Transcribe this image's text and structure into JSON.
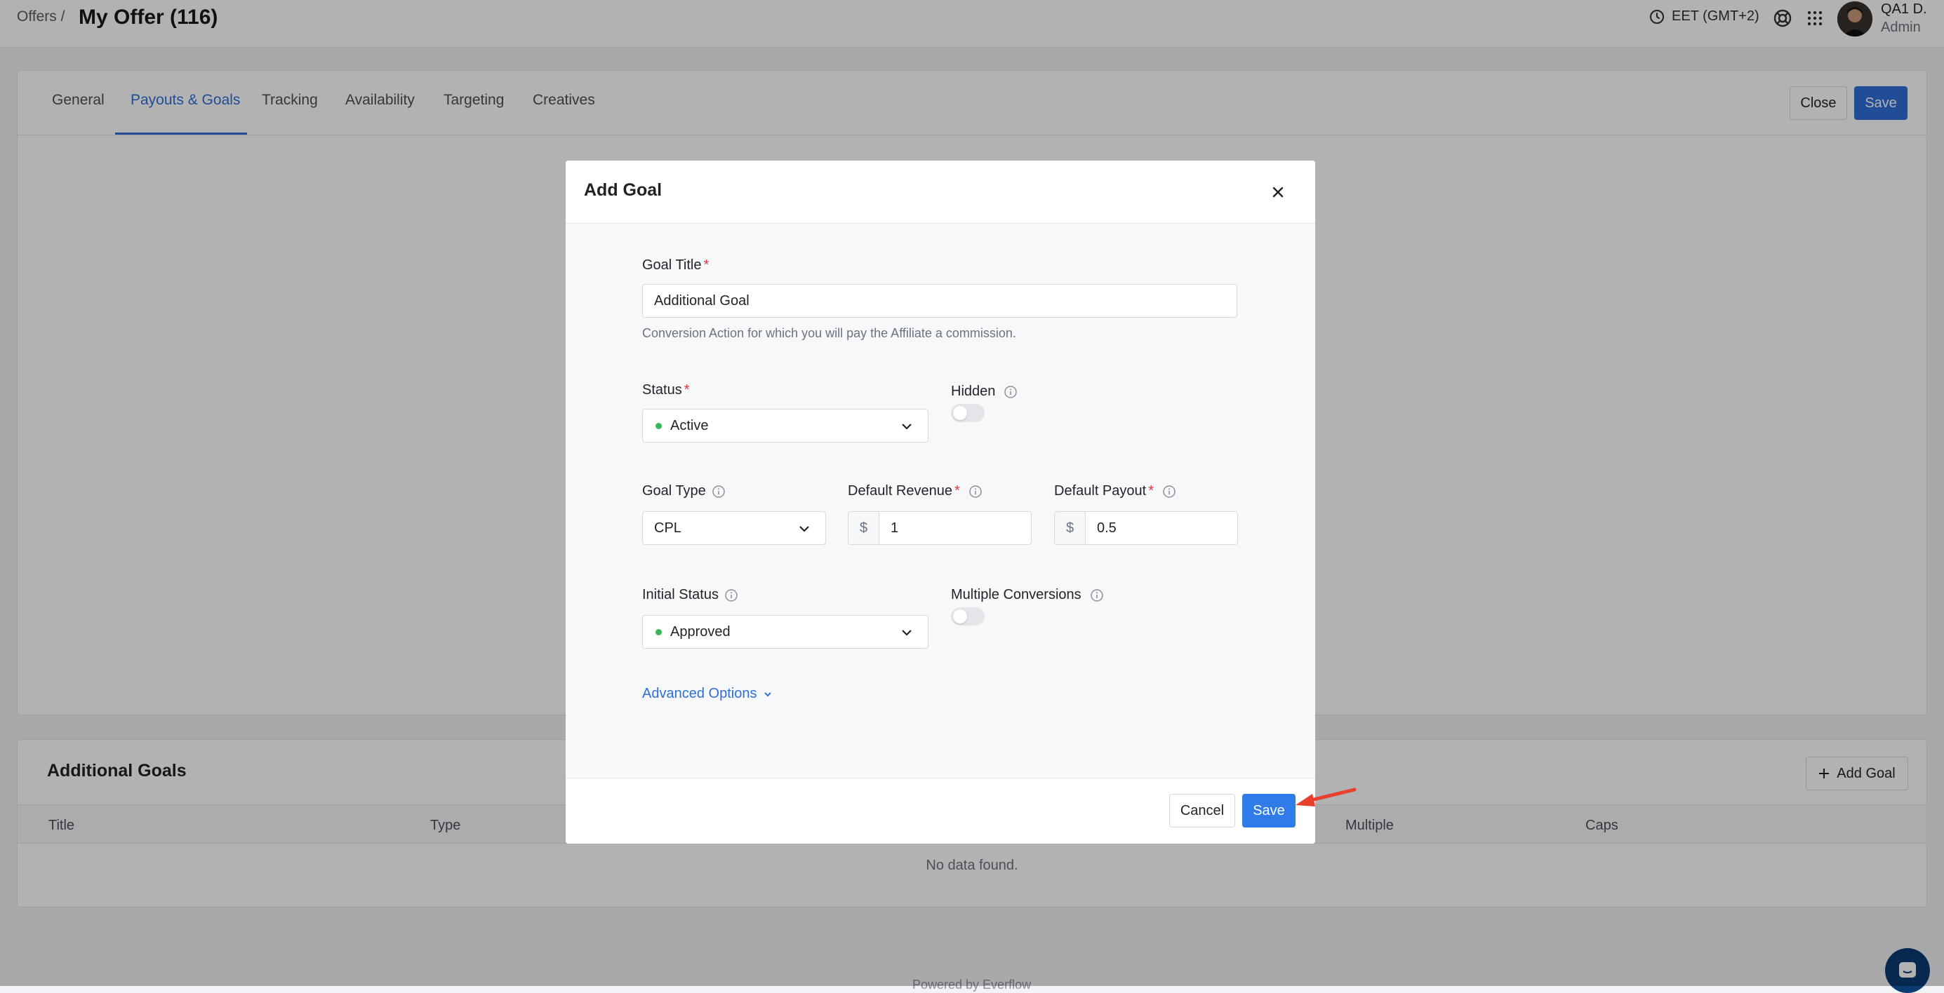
{
  "topbar": {
    "breadcrumb": "Offers /",
    "title": "My Offer (116)",
    "timezone": "EET (GMT+2)",
    "user_name": "QA1 D.",
    "user_role": "Admin"
  },
  "tabs": [
    {
      "label": "General"
    },
    {
      "label": "Payouts & Goals"
    },
    {
      "label": "Tracking"
    },
    {
      "label": "Availability"
    },
    {
      "label": "Targeting"
    },
    {
      "label": "Creatives"
    }
  ],
  "page_actions": {
    "close_label": "Close",
    "save_label": "Save"
  },
  "additional_goals": {
    "title": "Additional Goals",
    "add_button": "Add Goal",
    "columns": [
      "Title",
      "Type",
      "Multiple",
      "Caps"
    ],
    "empty_text": "No data found."
  },
  "footer": {
    "text": "Powered by Everflow"
  },
  "modal": {
    "title": "Add Goal",
    "goal_title": {
      "label": "Goal Title",
      "value": "Additional Goal",
      "help": "Conversion Action for which you will pay the Affiliate a commission."
    },
    "status": {
      "label": "Status",
      "value": "Active"
    },
    "hidden": {
      "label": "Hidden",
      "on": false
    },
    "goal_type": {
      "label": "Goal Type",
      "value": "CPL"
    },
    "default_revenue": {
      "label": "Default Revenue",
      "prefix": "$",
      "value": "1"
    },
    "default_payout": {
      "label": "Default Payout",
      "prefix": "$",
      "value": "0.5"
    },
    "initial_status": {
      "label": "Initial Status",
      "value": "Approved"
    },
    "multiple_conversions": {
      "label": "Multiple Conversions",
      "on": false
    },
    "advanced_options": "Advanced Options",
    "cancel_label": "Cancel",
    "save_label": "Save"
  },
  "colors": {
    "accent": "#2f6fd6",
    "status_green": "#3bb55b",
    "required": "#e0383e",
    "annotation_arrow": "#e8402f"
  }
}
